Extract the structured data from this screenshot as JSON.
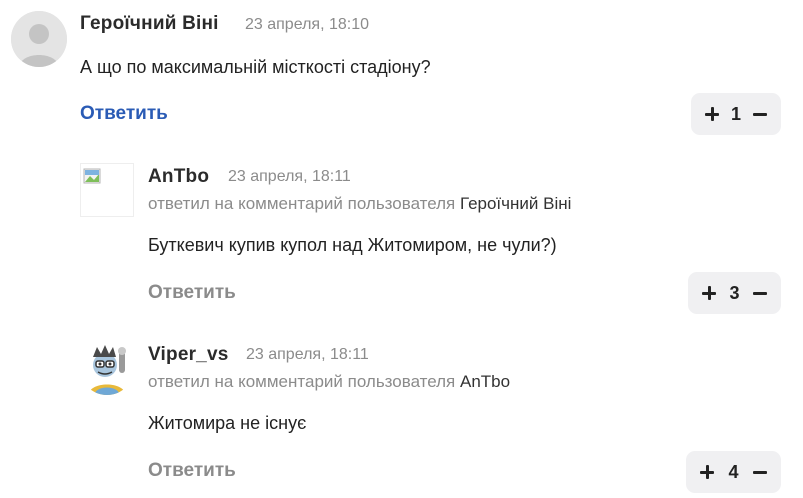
{
  "comments": [
    {
      "author": "Героїчний Віні",
      "time": "23 апреля, 18:10",
      "text": "А що по максимальній місткості стадіону?",
      "reply_label": "Ответить",
      "votes": "1"
    },
    {
      "author": "AnTbo",
      "time": "23 апреля, 18:11",
      "reply_prefix": "ответил на комментарий пользователя",
      "reply_user": "Героїчний Віні",
      "text": "Буткевич купив купол над Житомиром, не чули?)",
      "reply_label": "Ответить",
      "votes": "3"
    },
    {
      "author": "Viper_vs",
      "time": "23 апреля, 18:11",
      "reply_prefix": "ответил на комментарий пользователя",
      "reply_user": "AnTbo",
      "text": "Житомира не існує",
      "reply_label": "Ответить",
      "votes": "4"
    }
  ],
  "colors": {
    "link": "#2a5bb5",
    "muted": "#8b8b8b",
    "vote_bg": "#f0f0f2"
  },
  "icons": [
    "default-avatar-icon",
    "broken-image-icon",
    "cartoon-avatar-icon",
    "plus-icon",
    "minus-icon"
  ]
}
